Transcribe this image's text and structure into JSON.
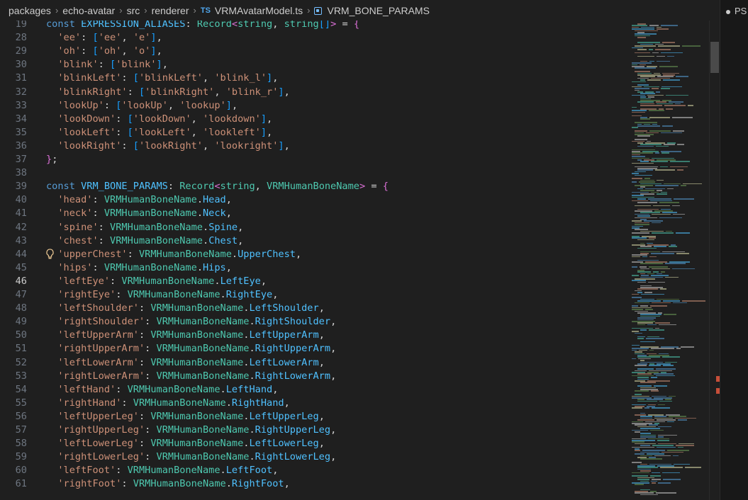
{
  "breadcrumb": {
    "items": [
      "packages",
      "echo-avatar",
      "src",
      "renderer"
    ],
    "file_type": "TS",
    "file_name": "VRMAvatarModel.ts",
    "symbol": "VRM_BONE_PARAMS"
  },
  "panel": {
    "label": "PS"
  },
  "editor": {
    "active_line": "46",
    "lines": [
      {
        "num": "19",
        "tokens": [
          [
            "kw",
            "const "
          ],
          [
            "cn",
            "EXPRESSION_ALIASES"
          ],
          [
            "pu",
            ": "
          ],
          [
            "ty",
            "Record"
          ],
          [
            "br",
            "<"
          ],
          [
            "ty",
            "string"
          ],
          [
            "pu",
            ", "
          ],
          [
            "ty",
            "string"
          ],
          [
            "br3",
            "[]"
          ],
          [
            "br",
            ">"
          ],
          [
            "pu",
            " = "
          ],
          [
            "br",
            "{"
          ]
        ]
      },
      {
        "num": "28",
        "tokens": [
          [
            "pu",
            "  "
          ],
          [
            "st",
            "'ee'"
          ],
          [
            "pu",
            ": "
          ],
          [
            "br3",
            "["
          ],
          [
            "st",
            "'ee'"
          ],
          [
            "pu",
            ", "
          ],
          [
            "st",
            "'e'"
          ],
          [
            "br3",
            "]"
          ],
          [
            "pu",
            ","
          ]
        ]
      },
      {
        "num": "29",
        "tokens": [
          [
            "pu",
            "  "
          ],
          [
            "st",
            "'oh'"
          ],
          [
            "pu",
            ": "
          ],
          [
            "br3",
            "["
          ],
          [
            "st",
            "'oh'"
          ],
          [
            "pu",
            ", "
          ],
          [
            "st",
            "'o'"
          ],
          [
            "br3",
            "]"
          ],
          [
            "pu",
            ","
          ]
        ]
      },
      {
        "num": "30",
        "tokens": [
          [
            "pu",
            "  "
          ],
          [
            "st",
            "'blink'"
          ],
          [
            "pu",
            ": "
          ],
          [
            "br3",
            "["
          ],
          [
            "st",
            "'blink'"
          ],
          [
            "br3",
            "]"
          ],
          [
            "pu",
            ","
          ]
        ]
      },
      {
        "num": "31",
        "tokens": [
          [
            "pu",
            "  "
          ],
          [
            "st",
            "'blinkLeft'"
          ],
          [
            "pu",
            ": "
          ],
          [
            "br3",
            "["
          ],
          [
            "st",
            "'blinkLeft'"
          ],
          [
            "pu",
            ", "
          ],
          [
            "st",
            "'blink_l'"
          ],
          [
            "br3",
            "]"
          ],
          [
            "pu",
            ","
          ]
        ]
      },
      {
        "num": "32",
        "tokens": [
          [
            "pu",
            "  "
          ],
          [
            "st",
            "'blinkRight'"
          ],
          [
            "pu",
            ": "
          ],
          [
            "br3",
            "["
          ],
          [
            "st",
            "'blinkRight'"
          ],
          [
            "pu",
            ", "
          ],
          [
            "st",
            "'blink_r'"
          ],
          [
            "br3",
            "]"
          ],
          [
            "pu",
            ","
          ]
        ]
      },
      {
        "num": "33",
        "tokens": [
          [
            "pu",
            "  "
          ],
          [
            "st",
            "'lookUp'"
          ],
          [
            "pu",
            ": "
          ],
          [
            "br3",
            "["
          ],
          [
            "st",
            "'lookUp'"
          ],
          [
            "pu",
            ", "
          ],
          [
            "st",
            "'lookup'"
          ],
          [
            "br3",
            "]"
          ],
          [
            "pu",
            ","
          ]
        ]
      },
      {
        "num": "34",
        "tokens": [
          [
            "pu",
            "  "
          ],
          [
            "st",
            "'lookDown'"
          ],
          [
            "pu",
            ": "
          ],
          [
            "br3",
            "["
          ],
          [
            "st",
            "'lookDown'"
          ],
          [
            "pu",
            ", "
          ],
          [
            "st",
            "'lookdown'"
          ],
          [
            "br3",
            "]"
          ],
          [
            "pu",
            ","
          ]
        ]
      },
      {
        "num": "35",
        "tokens": [
          [
            "pu",
            "  "
          ],
          [
            "st",
            "'lookLeft'"
          ],
          [
            "pu",
            ": "
          ],
          [
            "br3",
            "["
          ],
          [
            "st",
            "'lookLeft'"
          ],
          [
            "pu",
            ", "
          ],
          [
            "st",
            "'lookleft'"
          ],
          [
            "br3",
            "]"
          ],
          [
            "pu",
            ","
          ]
        ]
      },
      {
        "num": "36",
        "tokens": [
          [
            "pu",
            "  "
          ],
          [
            "st",
            "'lookRight'"
          ],
          [
            "pu",
            ": "
          ],
          [
            "br3",
            "["
          ],
          [
            "st",
            "'lookRight'"
          ],
          [
            "pu",
            ", "
          ],
          [
            "st",
            "'lookright'"
          ],
          [
            "br3",
            "]"
          ],
          [
            "pu",
            ","
          ]
        ]
      },
      {
        "num": "37",
        "tokens": [
          [
            "br",
            "}"
          ],
          [
            "pu",
            ";"
          ]
        ]
      },
      {
        "num": "38",
        "tokens": []
      },
      {
        "num": "39",
        "tokens": [
          [
            "kw",
            "const "
          ],
          [
            "cn",
            "VRM_BONE_PARAMS"
          ],
          [
            "pu",
            ": "
          ],
          [
            "ty",
            "Record"
          ],
          [
            "br",
            "<"
          ],
          [
            "ty",
            "string"
          ],
          [
            "pu",
            ", "
          ],
          [
            "ty",
            "VRMHumanBoneName"
          ],
          [
            "br",
            ">"
          ],
          [
            "pu",
            " = "
          ],
          [
            "br",
            "{"
          ]
        ]
      },
      {
        "num": "40",
        "tokens": [
          [
            "pu",
            "  "
          ],
          [
            "st",
            "'head'"
          ],
          [
            "pu",
            ": "
          ],
          [
            "ty",
            "VRMHumanBoneName"
          ],
          [
            "pu",
            "."
          ],
          [
            "pr",
            "Head"
          ],
          [
            "pu",
            ","
          ]
        ]
      },
      {
        "num": "41",
        "tokens": [
          [
            "pu",
            "  "
          ],
          [
            "st",
            "'neck'"
          ],
          [
            "pu",
            ": "
          ],
          [
            "ty",
            "VRMHumanBoneName"
          ],
          [
            "pu",
            "."
          ],
          [
            "pr",
            "Neck"
          ],
          [
            "pu",
            ","
          ]
        ]
      },
      {
        "num": "42",
        "tokens": [
          [
            "pu",
            "  "
          ],
          [
            "st",
            "'spine'"
          ],
          [
            "pu",
            ": "
          ],
          [
            "ty",
            "VRMHumanBoneName"
          ],
          [
            "pu",
            "."
          ],
          [
            "pr",
            "Spine"
          ],
          [
            "pu",
            ","
          ]
        ]
      },
      {
        "num": "43",
        "tokens": [
          [
            "pu",
            "  "
          ],
          [
            "st",
            "'chest'"
          ],
          [
            "pu",
            ": "
          ],
          [
            "ty",
            "VRMHumanBoneName"
          ],
          [
            "pu",
            "."
          ],
          [
            "pr",
            "Chest"
          ],
          [
            "pu",
            ","
          ]
        ]
      },
      {
        "num": "44",
        "tokens": [
          [
            "pu",
            "  "
          ],
          [
            "st",
            "'upperChest'"
          ],
          [
            "pu",
            ": "
          ],
          [
            "ty",
            "VRMHumanBoneName"
          ],
          [
            "pu",
            "."
          ],
          [
            "pr",
            "UpperChest"
          ],
          [
            "pu",
            ","
          ]
        ]
      },
      {
        "num": "45",
        "tokens": [
          [
            "pu",
            "  "
          ],
          [
            "st",
            "'hips'"
          ],
          [
            "pu",
            ": "
          ],
          [
            "ty",
            "VRMHumanBoneName"
          ],
          [
            "pu",
            "."
          ],
          [
            "pr",
            "Hips"
          ],
          [
            "pu",
            ","
          ]
        ]
      },
      {
        "num": "46",
        "tokens": [
          [
            "pu",
            "  "
          ],
          [
            "st",
            "'leftEye'"
          ],
          [
            "pu",
            ": "
          ],
          [
            "ty",
            "VRMHumanBoneName"
          ],
          [
            "pu",
            "."
          ],
          [
            "pr",
            "LeftEye"
          ],
          [
            "pu",
            ","
          ]
        ]
      },
      {
        "num": "47",
        "tokens": [
          [
            "pu",
            "  "
          ],
          [
            "st",
            "'rightEye'"
          ],
          [
            "pu",
            ": "
          ],
          [
            "ty",
            "VRMHumanBoneName"
          ],
          [
            "pu",
            "."
          ],
          [
            "pr",
            "RightEye"
          ],
          [
            "pu",
            ","
          ]
        ]
      },
      {
        "num": "48",
        "tokens": [
          [
            "pu",
            "  "
          ],
          [
            "st",
            "'leftShoulder'"
          ],
          [
            "pu",
            ": "
          ],
          [
            "ty",
            "VRMHumanBoneName"
          ],
          [
            "pu",
            "."
          ],
          [
            "pr",
            "LeftShoulder"
          ],
          [
            "pu",
            ","
          ]
        ]
      },
      {
        "num": "49",
        "tokens": [
          [
            "pu",
            "  "
          ],
          [
            "st",
            "'rightShoulder'"
          ],
          [
            "pu",
            ": "
          ],
          [
            "ty",
            "VRMHumanBoneName"
          ],
          [
            "pu",
            "."
          ],
          [
            "pr",
            "RightShoulder"
          ],
          [
            "pu",
            ","
          ]
        ]
      },
      {
        "num": "50",
        "tokens": [
          [
            "pu",
            "  "
          ],
          [
            "st",
            "'leftUpperArm'"
          ],
          [
            "pu",
            ": "
          ],
          [
            "ty",
            "VRMHumanBoneName"
          ],
          [
            "pu",
            "."
          ],
          [
            "pr",
            "LeftUpperArm"
          ],
          [
            "pu",
            ","
          ]
        ]
      },
      {
        "num": "51",
        "tokens": [
          [
            "pu",
            "  "
          ],
          [
            "st",
            "'rightUpperArm'"
          ],
          [
            "pu",
            ": "
          ],
          [
            "ty",
            "VRMHumanBoneName"
          ],
          [
            "pu",
            "."
          ],
          [
            "pr",
            "RightUpperArm"
          ],
          [
            "pu",
            ","
          ]
        ]
      },
      {
        "num": "52",
        "tokens": [
          [
            "pu",
            "  "
          ],
          [
            "st",
            "'leftLowerArm'"
          ],
          [
            "pu",
            ": "
          ],
          [
            "ty",
            "VRMHumanBoneName"
          ],
          [
            "pu",
            "."
          ],
          [
            "pr",
            "LeftLowerArm"
          ],
          [
            "pu",
            ","
          ]
        ]
      },
      {
        "num": "53",
        "tokens": [
          [
            "pu",
            "  "
          ],
          [
            "st",
            "'rightLowerArm'"
          ],
          [
            "pu",
            ": "
          ],
          [
            "ty",
            "VRMHumanBoneName"
          ],
          [
            "pu",
            "."
          ],
          [
            "pr",
            "RightLowerArm"
          ],
          [
            "pu",
            ","
          ]
        ]
      },
      {
        "num": "54",
        "tokens": [
          [
            "pu",
            "  "
          ],
          [
            "st",
            "'leftHand'"
          ],
          [
            "pu",
            ": "
          ],
          [
            "ty",
            "VRMHumanBoneName"
          ],
          [
            "pu",
            "."
          ],
          [
            "pr",
            "LeftHand"
          ],
          [
            "pu",
            ","
          ]
        ]
      },
      {
        "num": "55",
        "tokens": [
          [
            "pu",
            "  "
          ],
          [
            "st",
            "'rightHand'"
          ],
          [
            "pu",
            ": "
          ],
          [
            "ty",
            "VRMHumanBoneName"
          ],
          [
            "pu",
            "."
          ],
          [
            "pr",
            "RightHand"
          ],
          [
            "pu",
            ","
          ]
        ]
      },
      {
        "num": "56",
        "tokens": [
          [
            "pu",
            "  "
          ],
          [
            "st",
            "'leftUpperLeg'"
          ],
          [
            "pu",
            ": "
          ],
          [
            "ty",
            "VRMHumanBoneName"
          ],
          [
            "pu",
            "."
          ],
          [
            "pr",
            "LeftUpperLeg"
          ],
          [
            "pu",
            ","
          ]
        ]
      },
      {
        "num": "57",
        "tokens": [
          [
            "pu",
            "  "
          ],
          [
            "st",
            "'rightUpperLeg'"
          ],
          [
            "pu",
            ": "
          ],
          [
            "ty",
            "VRMHumanBoneName"
          ],
          [
            "pu",
            "."
          ],
          [
            "pr",
            "RightUpperLeg"
          ],
          [
            "pu",
            ","
          ]
        ]
      },
      {
        "num": "58",
        "tokens": [
          [
            "pu",
            "  "
          ],
          [
            "st",
            "'leftLowerLeg'"
          ],
          [
            "pu",
            ": "
          ],
          [
            "ty",
            "VRMHumanBoneName"
          ],
          [
            "pu",
            "."
          ],
          [
            "pr",
            "LeftLowerLeg"
          ],
          [
            "pu",
            ","
          ]
        ]
      },
      {
        "num": "59",
        "tokens": [
          [
            "pu",
            "  "
          ],
          [
            "st",
            "'rightLowerLeg'"
          ],
          [
            "pu",
            ": "
          ],
          [
            "ty",
            "VRMHumanBoneName"
          ],
          [
            "pu",
            "."
          ],
          [
            "pr",
            "RightLowerLeg"
          ],
          [
            "pu",
            ","
          ]
        ]
      },
      {
        "num": "60",
        "tokens": [
          [
            "pu",
            "  "
          ],
          [
            "st",
            "'leftFoot'"
          ],
          [
            "pu",
            ": "
          ],
          [
            "ty",
            "VRMHumanBoneName"
          ],
          [
            "pu",
            "."
          ],
          [
            "pr",
            "LeftFoot"
          ],
          [
            "pu",
            ","
          ]
        ]
      },
      {
        "num": "61",
        "tokens": [
          [
            "pu",
            "  "
          ],
          [
            "st",
            "'rightFoot'"
          ],
          [
            "pu",
            ": "
          ],
          [
            "ty",
            "VRMHumanBoneName"
          ],
          [
            "pu",
            "."
          ],
          [
            "pr",
            "RightFoot"
          ],
          [
            "pu",
            ","
          ]
        ]
      }
    ]
  },
  "colors": {
    "background": "#1f1f1f",
    "keyword": "#569cd6",
    "constant": "#4fc1ff",
    "type": "#4ec9b0",
    "string": "#ce9178",
    "error_marker": "#c74e39"
  }
}
